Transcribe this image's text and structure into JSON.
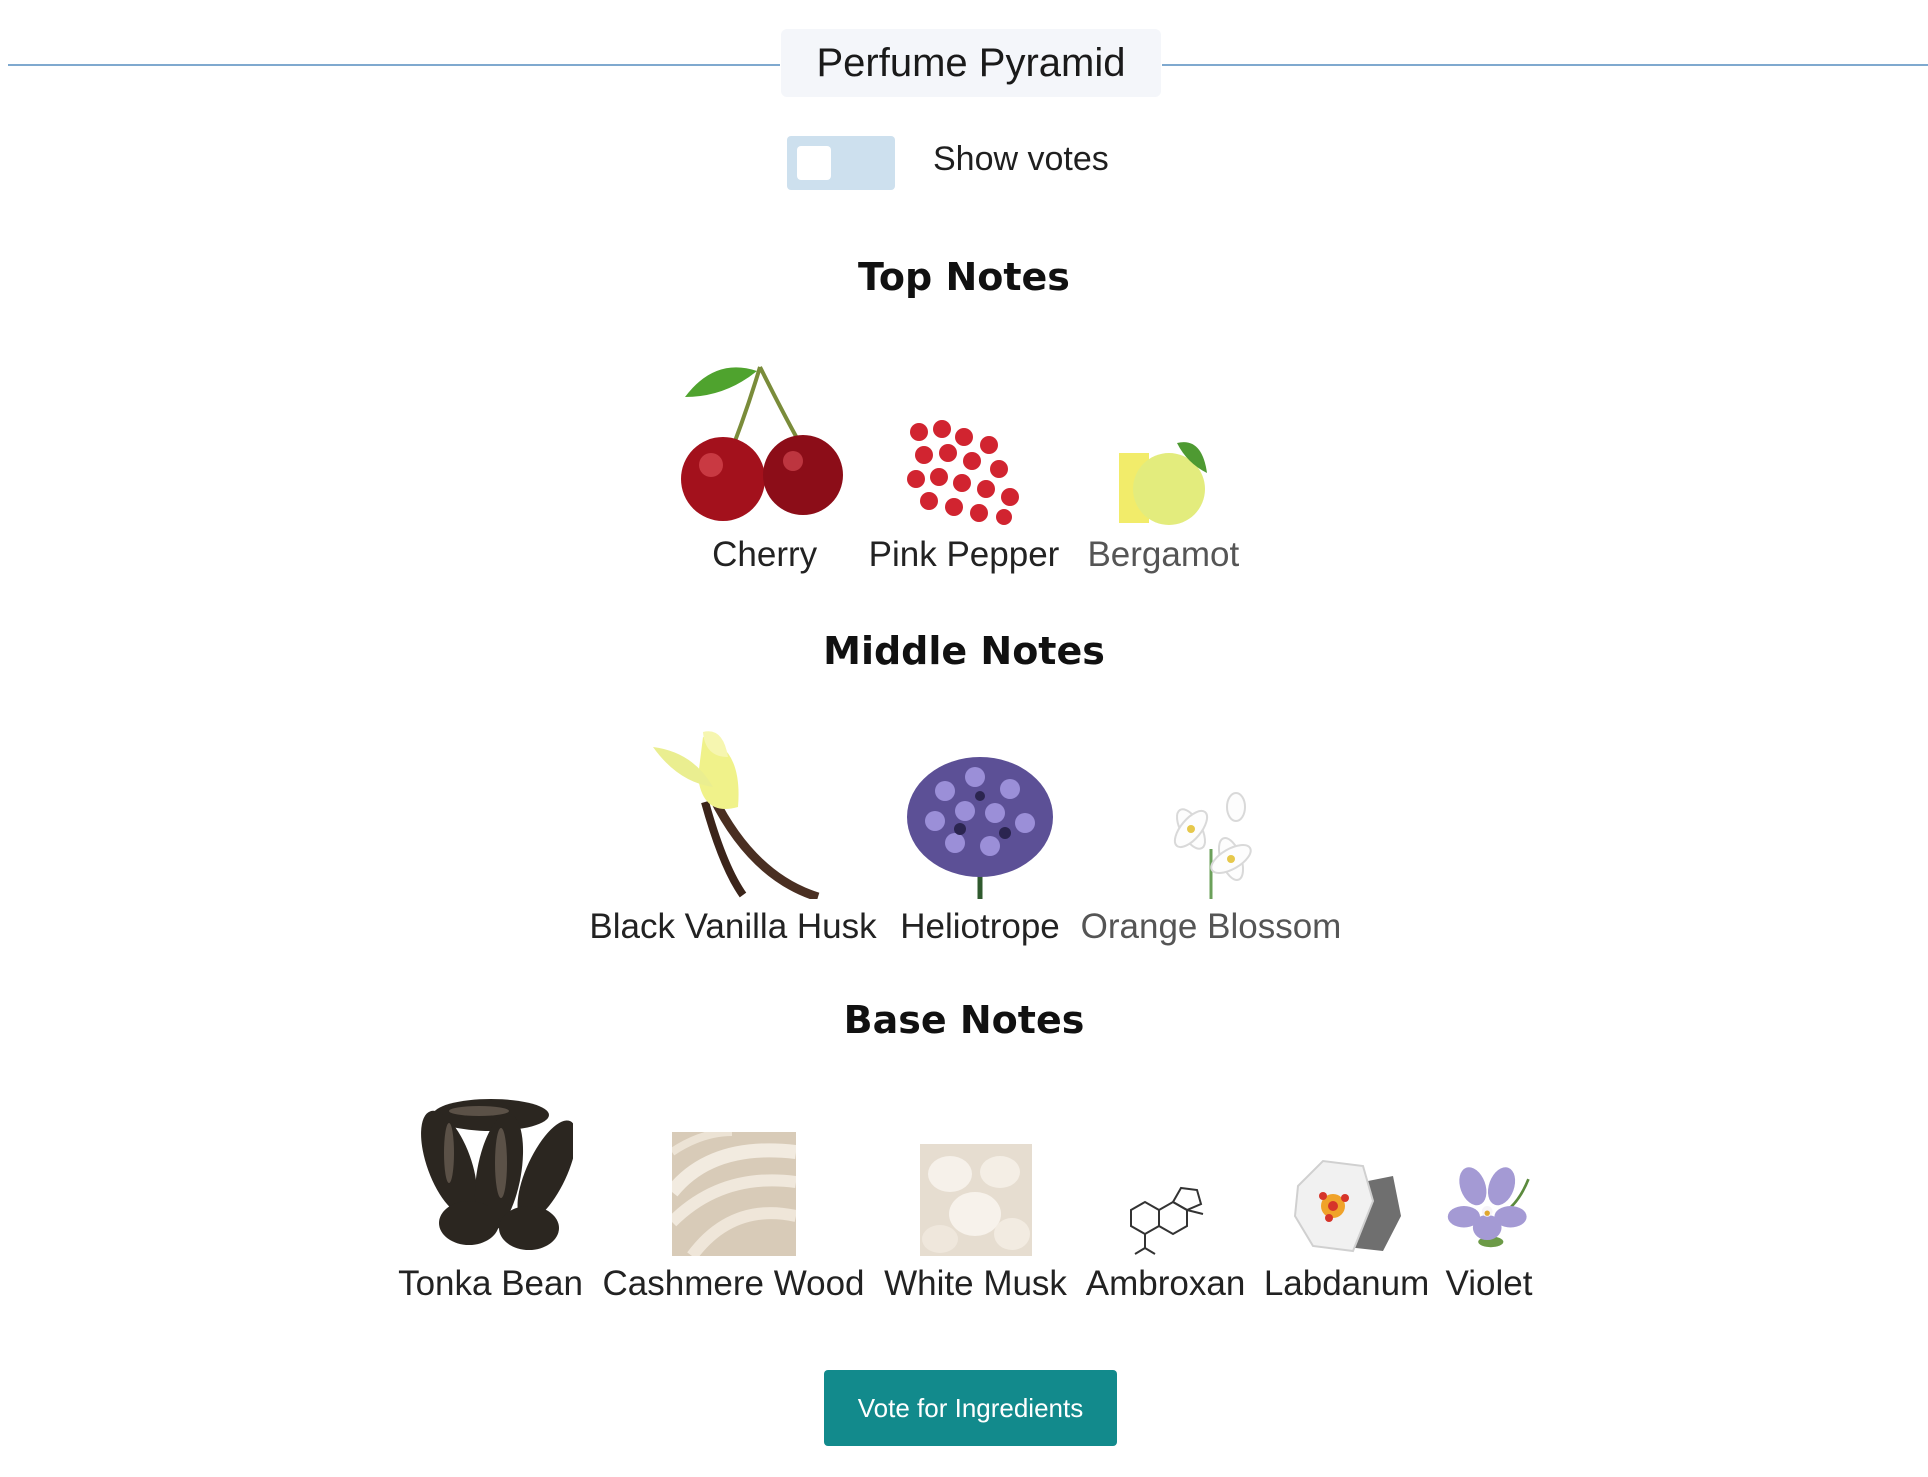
{
  "header": {
    "title": "Perfume Pyramid"
  },
  "toggle": {
    "label": "Show votes",
    "checked": false
  },
  "sections": [
    {
      "title": "Top Notes",
      "notes": [
        {
          "label": "Cherry",
          "icon": "cherry-icon"
        },
        {
          "label": "Pink Pepper",
          "icon": "pink-pepper-icon"
        },
        {
          "label": "Bergamot",
          "icon": "bergamot-icon"
        }
      ]
    },
    {
      "title": "Middle Notes",
      "notes": [
        {
          "label": "Black Vanilla Husk",
          "icon": "vanilla-icon"
        },
        {
          "label": "Heliotrope",
          "icon": "heliotrope-icon"
        },
        {
          "label": "Orange Blossom",
          "icon": "orange-blossom-icon"
        }
      ]
    },
    {
      "title": "Base Notes",
      "notes": [
        {
          "label": "Tonka Bean",
          "icon": "tonka-bean-icon"
        },
        {
          "label": "Cashmere Wood",
          "icon": "cashmere-wood-icon"
        },
        {
          "label": "White Musk",
          "icon": "white-musk-icon"
        },
        {
          "label": "Ambroxan",
          "icon": "ambroxan-molecule-icon"
        },
        {
          "label": "Labdanum",
          "icon": "labdanum-icon"
        },
        {
          "label": "Violet",
          "icon": "violet-icon"
        }
      ]
    }
  ],
  "actions": {
    "vote_label": "Vote for Ingredients"
  },
  "colors": {
    "accent": "#128a8c",
    "divider": "#7fa9cf",
    "toggle_track": "#cde0ee"
  }
}
